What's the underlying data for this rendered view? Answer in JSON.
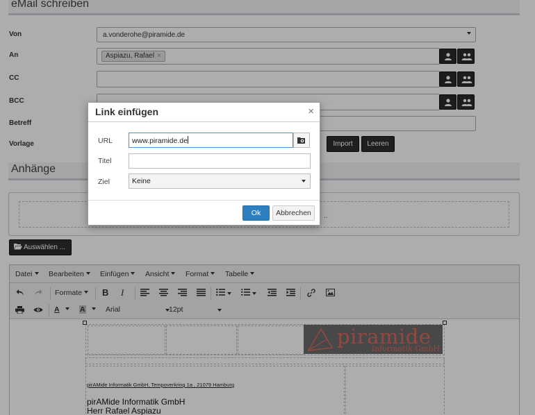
{
  "email_section": {
    "title": "eMail schreiben"
  },
  "form": {
    "von_label": "Von",
    "von_value": "a.vonderohe@piramide.de",
    "an_label": "An",
    "an_tag": "Aspiazu, Rafael",
    "tag_remove": "×",
    "cc_label": "CC",
    "bcc_label": "BCC",
    "betreff_label": "Betreff",
    "vorlage_label": "Vorlage",
    "import_label": "Import",
    "leeren_label": "Leeren"
  },
  "attachments": {
    "title": "Anhänge",
    "dropzone_hint": "..",
    "select_button": "Auswählen ..."
  },
  "editor": {
    "menu": [
      "Datei",
      "Bearbeiten",
      "Einfügen",
      "Ansicht",
      "Format",
      "Tabelle"
    ],
    "format_label": "Formate",
    "bold": "B",
    "italic": "I",
    "font_family": "Arial",
    "font_size": "12pt",
    "text_color_glyph": "A",
    "bg_color_glyph": "A"
  },
  "signature": {
    "logo_main": "piramide",
    "logo_sub": "Informatik GmbH",
    "address_line": "pirAMide Informatik GmbH,  Tempoverkring 1a , 21079 Hamburg",
    "company": "pirAMide Informatik GmbH",
    "person": "Herr Rafael Aspiazu"
  },
  "dialog": {
    "title": "Link einfügen",
    "close": "×",
    "url_label": "URL",
    "url_value": "www.piramide.de",
    "title_label": "Titel",
    "title_value": "",
    "target_label": "Ziel",
    "target_value": "Keine",
    "ok_label": "Ok",
    "cancel_label": "Abbrechen"
  },
  "colors": {
    "primary": "#2e7fc0",
    "dark_button": "#2f2f2f",
    "logo_accent": "#d96a60"
  }
}
